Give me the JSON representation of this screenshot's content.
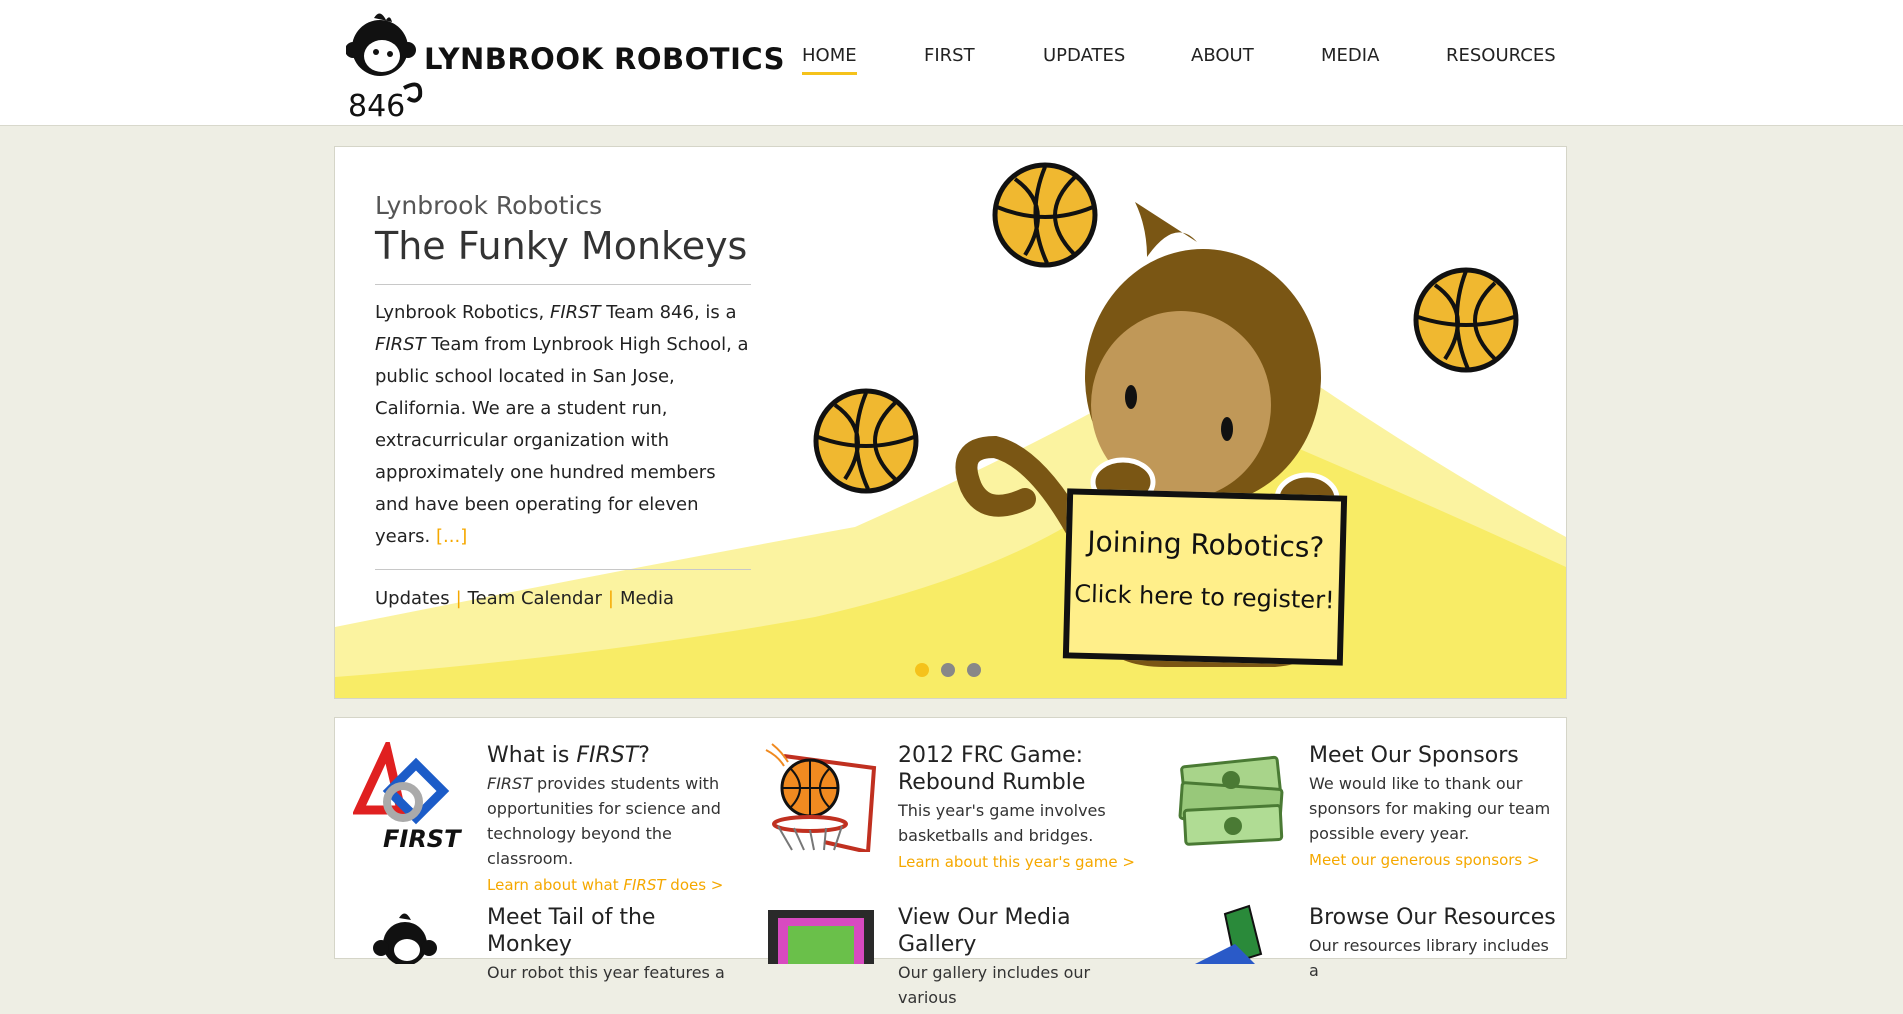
{
  "header": {
    "logo_text": "LYNBROOK ROBOTICS",
    "logo_number": "846",
    "nav": [
      {
        "label": "HOME",
        "active": true
      },
      {
        "label": "FIRST",
        "active": false
      },
      {
        "label": "UPDATES",
        "active": false
      },
      {
        "label": "ABOUT",
        "active": false
      },
      {
        "label": "MEDIA",
        "active": false
      },
      {
        "label": "RESOURCES",
        "active": false
      }
    ]
  },
  "hero": {
    "subtitle": "Lynbrook Robotics",
    "title": "The Funky Monkeys",
    "body_p1": "Lynbrook Robotics, ",
    "body_first1": "FIRST",
    "body_p2": " Team 846, is a ",
    "body_first2": "FIRST",
    "body_p3": " Team from Lynbrook High School, a public school located in San Jose, California. We are a student run, extracurricular organization with approximately one hundred members and have been operating for eleven years.",
    "more_link": "[...]",
    "links": [
      "Updates",
      "Team Calendar",
      "Media"
    ],
    "link_separator": "|",
    "sign_line1": "Joining Robotics?",
    "sign_line2": "Click here to register!",
    "slides_count": 3,
    "active_slide": 0
  },
  "cards": [
    {
      "title_pre": "What is ",
      "title_em": "FIRST",
      "title_post": "?",
      "desc_em": "FIRST",
      "desc": " provides students with opportunities for science and technology beyond the classroom.",
      "link_pre": "Learn about what ",
      "link_em": "FIRST",
      "link_post": " does >",
      "icon_label": "FIRST"
    },
    {
      "title": "2012 FRC Game: Rebound Rumble",
      "desc": "This year's game involves basketballs and bridges.",
      "link": "Learn about this year's game >"
    },
    {
      "title": "Meet Our Sponsors",
      "desc": "We would like to thank our sponsors for making our team possible every year.",
      "link": "Meet our generous sponsors >"
    },
    {
      "title": "Meet Tail of the Monkey",
      "desc": "Our robot this year features a"
    },
    {
      "title": "View Our Media Gallery",
      "desc": "Our gallery includes our various"
    },
    {
      "title": "Browse Our Resources",
      "desc": "Our resources library includes a"
    }
  ],
  "colors": {
    "accent": "#f5c21b",
    "link": "#f5a800",
    "page_bg": "#eeeee4",
    "monkey_brown": "#7a5614",
    "ball_orange": "#f0b830"
  }
}
